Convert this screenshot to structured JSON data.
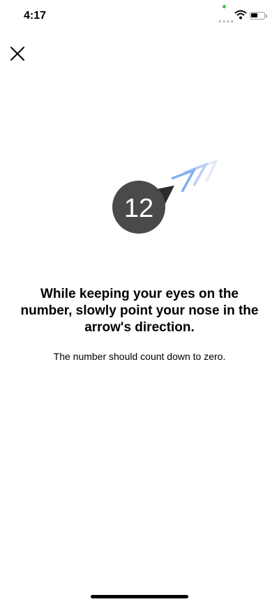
{
  "status_bar": {
    "time": "4:17"
  },
  "exercise": {
    "countdown": "12",
    "instruction": "While keeping your eyes on the number, slowly point your nose in the arrow's direction.",
    "hint": "The number should count down to zero."
  },
  "colors": {
    "circle": "#4a4a4a",
    "arrow": "#7fb0ef"
  }
}
